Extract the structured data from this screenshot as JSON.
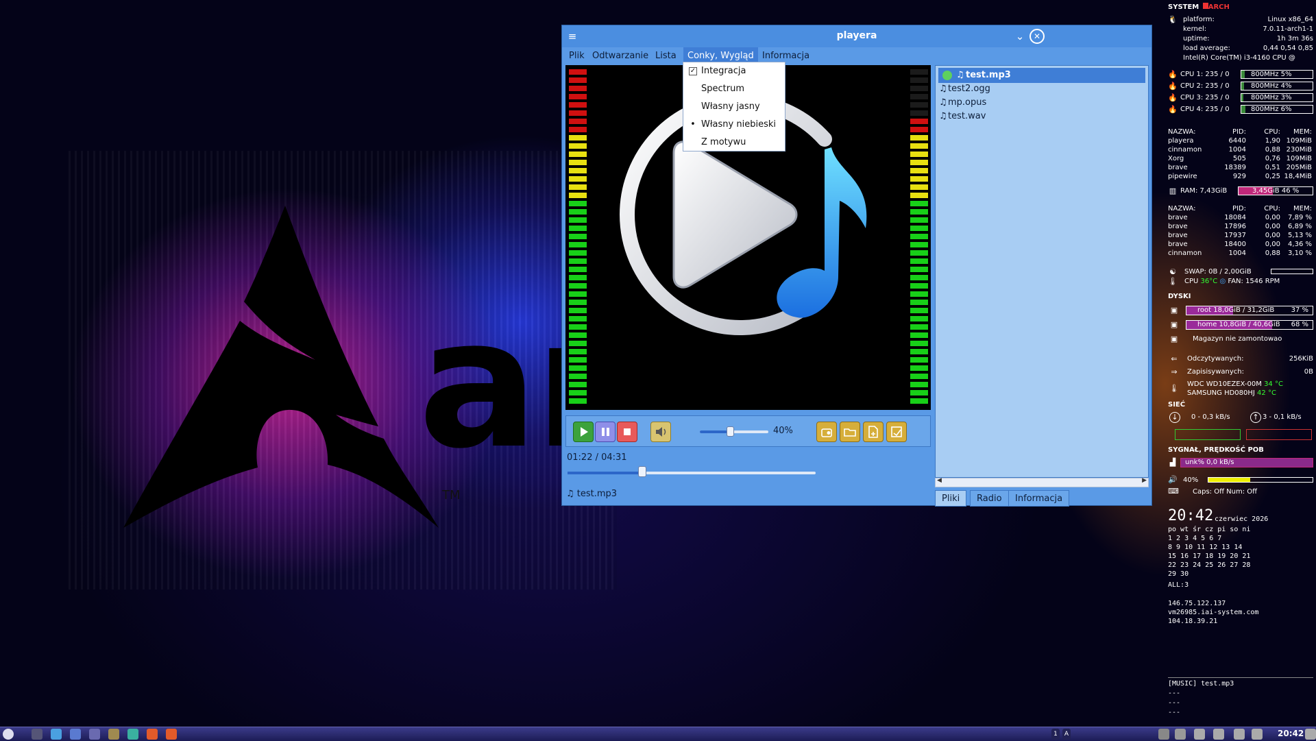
{
  "player": {
    "title": "playera",
    "menu": [
      "Plik",
      "Odtwarzanie",
      "Lista",
      "Conky, Wygląd",
      "Informacja"
    ],
    "dropdown": [
      {
        "mark": "✓",
        "label": "Integracja"
      },
      {
        "mark": "",
        "label": "Spectrum"
      },
      {
        "mark": "",
        "label": "Własny jasny"
      },
      {
        "mark": "•",
        "label": "Własny niebieski"
      },
      {
        "mark": "",
        "label": "Z motywu"
      }
    ],
    "volume_text": "40%",
    "volume_level": 0.4,
    "time": "01:22 / 04:31",
    "progress": 0.3,
    "now_playing": "test.mp3",
    "playlist": [
      "test.mp3",
      "test2.ogg",
      "mp.opus",
      "test.wav"
    ],
    "tabs": [
      "Pliki",
      "Radio",
      "Informacja"
    ],
    "icons": {
      "menu": "hamburger-icon",
      "minimize": "chevron-down-icon",
      "close": "close-icon",
      "note": "music-note-icon"
    }
  },
  "conky": {
    "header": "SYSTEM",
    "header_brand": "ARCH",
    "platform_label": "platform:",
    "platform": "Linux x86_64",
    "kernel_label": "kernel:",
    "kernel": "7.0.11-arch1-1",
    "uptime_label": "uptime:",
    "uptime": "1h 3m 36s",
    "load_label": "load average:",
    "load": "0,44 0,54 0,85",
    "cpu_model": "Intel(R) Core(TM) i3-4160 CPU @",
    "cpus": [
      {
        "label": "CPU 1: 235 / 0",
        "bar": "800MHz   5%",
        "pct": 5
      },
      {
        "label": "CPU 2: 235 / 0",
        "bar": "800MHz   4%",
        "pct": 4
      },
      {
        "label": "CPU 3: 235 / 0",
        "bar": "800MHz   3%",
        "pct": 3
      },
      {
        "label": "CPU 4: 235 / 0",
        "bar": "800MHz   6%",
        "pct": 6
      }
    ],
    "proc_cpu_header": [
      "NAZWA:",
      "PID:",
      "CPU:",
      "MEM:"
    ],
    "proc_cpu": [
      [
        "playera",
        "6440",
        "1,90",
        "109MiB"
      ],
      [
        "cinnamon",
        "1004",
        "0,88",
        "230MiB"
      ],
      [
        "Xorg",
        "505",
        "0,76",
        "109MiB"
      ],
      [
        "brave",
        "18389",
        "0,51",
        "205MiB"
      ],
      [
        "pipewire",
        "929",
        "0,25",
        "18,4MiB"
      ]
    ],
    "ram_label": "RAM: 7,43GiB",
    "ram_bar": "3,45GiB   46 %",
    "ram_pct": 46,
    "proc_mem_header": [
      "NAZWA:",
      "PID:",
      "CPU:",
      "MEM:"
    ],
    "proc_mem": [
      [
        "brave",
        "18084",
        "0,00",
        "7,89 %"
      ],
      [
        "brave",
        "17896",
        "0,00",
        "6,89 %"
      ],
      [
        "brave",
        "17937",
        "0,00",
        "5,13 %"
      ],
      [
        "brave",
        "18400",
        "0,00",
        "4,36 %"
      ],
      [
        "cinnamon",
        "1004",
        "0,88",
        "3,10 %"
      ]
    ],
    "swap": "SWAP: 0B / 2,00GiB",
    "cpu_temp_label": "CPU",
    "cpu_temp": "36°C",
    "fan": "FAN: 1546 RPM",
    "disks_header": "DYSKI",
    "disks": [
      {
        "text": "root  18,0GiB / 31,2GiB",
        "pct_text": "37 %",
        "pct": 37
      },
      {
        "text": "home  10,8GiB / 40,6GiB",
        "pct_text": "68 %",
        "pct": 68
      }
    ],
    "not_mounted": "Magazyn nie zamontowao",
    "read_label": "Odczytywanych:",
    "read": "256KiB",
    "write_label": "Zapisisywanych:",
    "write": "0B",
    "hdd1": "WDC WD10EZEX-00M",
    "hdd1_temp": "34 °C",
    "hdd2": "SAMSUNG HD080HJ",
    "hdd2_temp": "42 °C",
    "net_header": "SIEĆ",
    "down": "0 - 0,3 kB/s",
    "up": "3 - 0,1 kB/s",
    "signal_header": "SYGNAŁ, PRĘDKOŚĆ POB",
    "signal_bar": "unk%  0,0 kB/s",
    "volume": "40%",
    "volume_pct": 40,
    "caps": "Caps: Off   Num: Off",
    "clock": "20:42",
    "month": "czerwiec 2026",
    "weekdays": "po wt śr cz pi so ni",
    "cal_rows": [
      " 1  2  3  4  5  6  7",
      " 8  9 10 11 12 13 14",
      "15 16 17 18 19 20 21",
      "22 23 24 25 26 27 28",
      "29 30"
    ],
    "all": "ALL:3",
    "ips": [
      "146.75.122.137",
      "vm26985.iai-system.com",
      "104.18.39.21"
    ],
    "music": "[MUSIC] test.mp3",
    "dashes": [
      "---",
      "---",
      "---"
    ]
  },
  "desktop": {
    "tm": "TM"
  },
  "taskbar": {
    "clock": "20:42",
    "workspaces": [
      "1",
      "A"
    ]
  }
}
